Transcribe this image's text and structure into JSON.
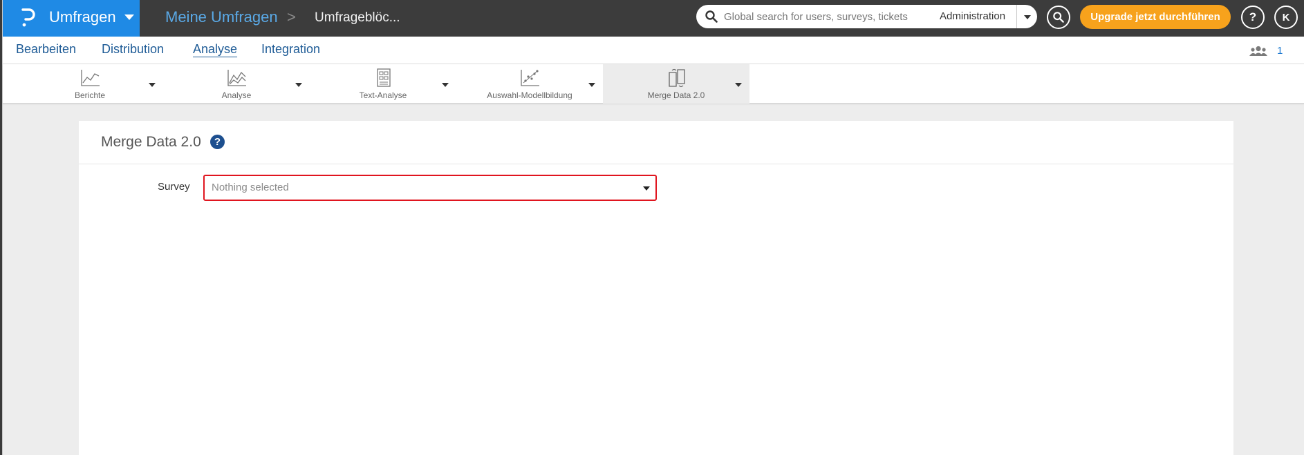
{
  "brand": {
    "label": "Umfragen",
    "logo_icon": "brand-p-logo-icon",
    "color": "#1f8ae5"
  },
  "breadcrumb": {
    "root": "Meine Umfragen",
    "separator": ">",
    "current": "Umfrageblöc..."
  },
  "search": {
    "placeholder": "Global search for users, surveys, tickets",
    "scope": "Administration"
  },
  "header_actions": {
    "upgrade_label": "Upgrade jetzt durchführen",
    "help_label": "?",
    "avatar_initial": "K",
    "upgrade_color": "#f7a21c"
  },
  "nav": {
    "tabs": [
      {
        "label": "Bearbeiten"
      },
      {
        "label": "Distribution"
      },
      {
        "label": "Analyse",
        "active": true
      },
      {
        "label": "Integration"
      }
    ],
    "users_count": "1"
  },
  "toolbar": {
    "items": [
      {
        "label": "Berichte",
        "icon": "line-chart-icon"
      },
      {
        "label": "Analyse",
        "icon": "multi-line-chart-icon"
      },
      {
        "label": "Text-Analyse",
        "icon": "text-document-icon"
      },
      {
        "label": "Auswahl-Modellbildung",
        "icon": "scatter-chart-icon"
      },
      {
        "label": "Merge Data 2.0",
        "icon": "merge-documents-icon",
        "active": true
      }
    ]
  },
  "panel": {
    "title": "Merge Data 2.0",
    "help_label": "?",
    "survey_label": "Survey",
    "survey_placeholder": "Nothing selected",
    "highlight_color": "#e0151f"
  }
}
